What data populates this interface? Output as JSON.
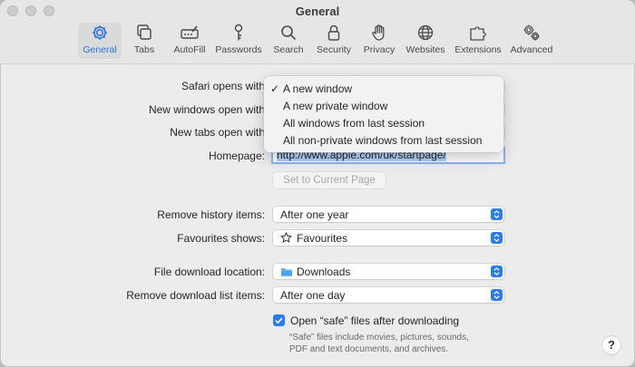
{
  "window": {
    "title": "General"
  },
  "toolbar": {
    "tabs": [
      {
        "label": "General",
        "icon": "gear-icon",
        "active": true
      },
      {
        "label": "Tabs",
        "icon": "tabs-icon"
      },
      {
        "label": "AutoFill",
        "icon": "autofill-icon"
      },
      {
        "label": "Passwords",
        "icon": "key-icon"
      },
      {
        "label": "Search",
        "icon": "search-icon"
      },
      {
        "label": "Security",
        "icon": "lock-icon"
      },
      {
        "label": "Privacy",
        "icon": "hand-icon"
      },
      {
        "label": "Websites",
        "icon": "globe-icon"
      },
      {
        "label": "Extensions",
        "icon": "puzzle-icon"
      },
      {
        "label": "Advanced",
        "icon": "gears-icon"
      }
    ]
  },
  "settings": {
    "safari_opens_with": {
      "label": "Safari opens with"
    },
    "new_windows_open_with": {
      "label": "New windows open with"
    },
    "new_tabs_open_with": {
      "label": "New tabs open with"
    },
    "homepage": {
      "label": "Homepage:",
      "value": "http://www.apple.com/uk/startpage/"
    },
    "set_current_page_label": "Set to Current Page",
    "remove_history_items": {
      "label": "Remove history items:",
      "value": "After one year"
    },
    "favourites_shows": {
      "label": "Favourites shows:",
      "value": "Favourites"
    },
    "file_download_location": {
      "label": "File download location:",
      "value": "Downloads"
    },
    "remove_download_list_items": {
      "label": "Remove download list items:",
      "value": "After one day"
    },
    "open_safe_files": {
      "label": "Open “safe” files after downloading",
      "checked": true
    },
    "safe_files_note_line1": "“Safe” files include movies, pictures, sounds,",
    "safe_files_note_line2": "PDF and text documents, and archives."
  },
  "dropdown_menu": {
    "items": [
      {
        "label": "A new window",
        "checked": true
      },
      {
        "label": "A new private window"
      },
      {
        "label": "All windows from last session"
      },
      {
        "label": "All non-private windows from last session"
      }
    ],
    "checkmark": "✓"
  },
  "help_button": {
    "label": "?"
  },
  "colors": {
    "accent": "#2a7cf5",
    "active_tab_text": "#2a74e0",
    "folder": "#4aa3f0"
  }
}
